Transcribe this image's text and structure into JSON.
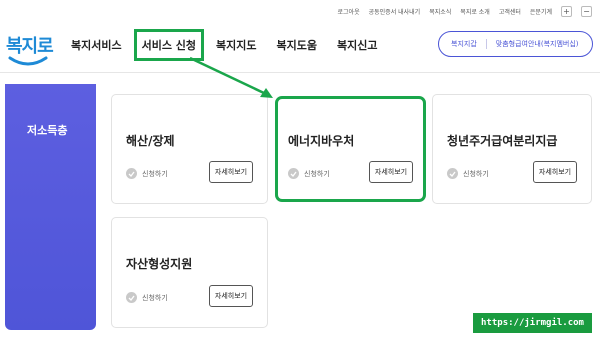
{
  "utility": [
    "로그아웃",
    "공동인증서 내사내기",
    "복지소식",
    "복지로 소개",
    "고객센터",
    "은문기계"
  ],
  "utility_plus": "+",
  "utility_minus": "−",
  "logo_text": "복지로",
  "nav": [
    "복지서비스",
    "서비스 신청",
    "복지지도",
    "복지도움",
    "복지신고"
  ],
  "pill": {
    "left": "복지지갑",
    "right": "맞춤형급여안내(복지멤버십)"
  },
  "sidebar_label": "저소득층",
  "cards": [
    {
      "title": "해산/장제",
      "apply": "신청하기",
      "detail": "자세히보기"
    },
    {
      "title": "에너지바우처",
      "apply": "신청하기",
      "detail": "자세히보기"
    },
    {
      "title": "청년주거급여분리지급",
      "apply": "신청하기",
      "detail": "자세히보기"
    },
    {
      "title": "자산형성지원",
      "apply": "신청하기",
      "detail": "자세히보기"
    }
  ],
  "watermark": "https://jirmgil.com",
  "colors": {
    "accent": "#4b55d6",
    "highlight": "#1aa64b",
    "logo": "#1e8ad6"
  }
}
